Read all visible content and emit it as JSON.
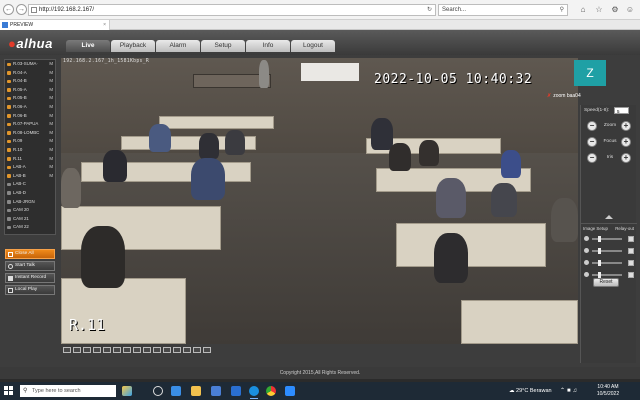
{
  "browser": {
    "url": "http://192.168.2.167/",
    "search_placeholder": "Search...",
    "tab_title": "PREVIEW"
  },
  "app": {
    "logo": "alhua",
    "menu": [
      {
        "label": "Live",
        "active": true
      },
      {
        "label": "Playback"
      },
      {
        "label": "Alarm"
      },
      {
        "label": "Setup"
      },
      {
        "label": "Info"
      },
      {
        "label": "Logout"
      }
    ]
  },
  "camera_list": [
    {
      "name": "R.03-SUMA·",
      "m": "M"
    },
    {
      "name": "R.04-A",
      "m": "M"
    },
    {
      "name": "R.04-B",
      "m": "M"
    },
    {
      "name": "R.05-A",
      "m": "M"
    },
    {
      "name": "R.05-B",
      "m": "M"
    },
    {
      "name": "R.06-A",
      "m": "M"
    },
    {
      "name": "R.06-B",
      "m": "M"
    },
    {
      "name": "R.07-PAPUA",
      "m": "M"
    },
    {
      "name": "R.08-LOMBC",
      "m": "M"
    },
    {
      "name": "R.09",
      "m": "M"
    },
    {
      "name": "R.10",
      "m": "M"
    },
    {
      "name": "R.11",
      "m": "M"
    },
    {
      "name": "LAB-A",
      "m": "M"
    },
    {
      "name": "LAB-B",
      "m": "M"
    },
    {
      "name": "LAB-C",
      "m": ""
    },
    {
      "name": "LAB-D",
      "m": ""
    },
    {
      "name": "LAB-JRGN",
      "m": ""
    },
    {
      "name": "CAM 20",
      "m": ""
    },
    {
      "name": "CAM 21",
      "m": ""
    },
    {
      "name": "CAM 22",
      "m": ""
    }
  ],
  "controls": {
    "close_all": "Close All",
    "start_talk": "Start Talk",
    "instant_record": "Instant Record",
    "local_play": "Local Play"
  },
  "video": {
    "info_line": "192.168.2.167_1h_1581Kbps_R",
    "timestamp": "2022-10-05 10:40:32",
    "camera_name": "R.11"
  },
  "zoom_overlay": {
    "avatar_letter": "Z",
    "label": "zoom baa04"
  },
  "ptz": {
    "speed_label": "Speed(1-8):",
    "speed_value": "5",
    "zoom": "Zoom",
    "focus": "Focus",
    "iris": "Iris",
    "image_setup": "Image Setup",
    "relay_out": "Relay-out",
    "reset": "Reset",
    "sliders": [
      {
        "name": "brightness",
        "level": 0.25
      },
      {
        "name": "contrast",
        "level": 0.25
      },
      {
        "name": "saturation",
        "level": 0.25
      },
      {
        "name": "hue",
        "level": 0.25
      }
    ]
  },
  "footer": {
    "copyright": "Copyright 2015,All Rights Reserved."
  },
  "taskbar": {
    "search_placeholder": "Type here to search",
    "weather": "29°C Berawan",
    "time": "10:40 AM",
    "date": "10/5/2022"
  }
}
